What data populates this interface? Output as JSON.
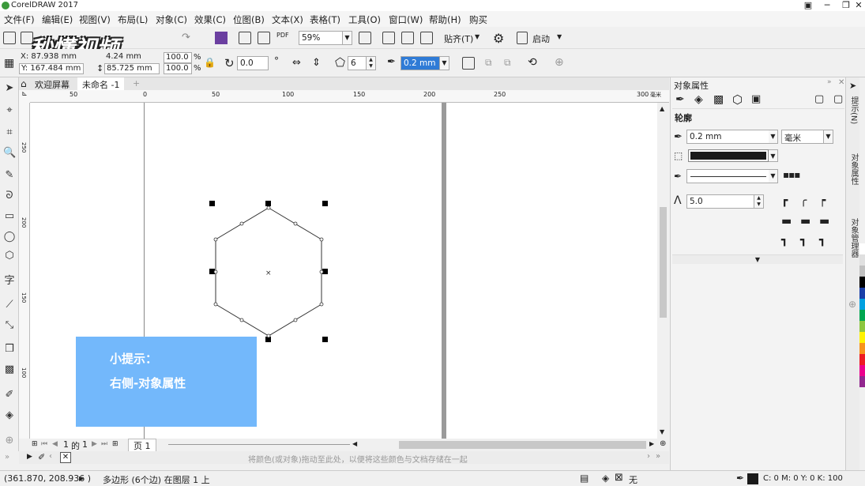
{
  "window": {
    "title": "CorelDRAW 2017",
    "buttons": [
      "─",
      "❐",
      "✕"
    ]
  },
  "menu": [
    "文件(F)",
    "编辑(E)",
    "视图(V)",
    "布局(L)",
    "对象(C)",
    "效果(C)",
    "位图(B)",
    "文本(X)",
    "表格(T)",
    "工具(O)",
    "窗口(W)",
    "帮助(H)",
    "购买"
  ],
  "watermark": "秒懂视频",
  "toolbar1": {
    "zoom": "59%",
    "snap_label": "贴齐(T)",
    "launch_label": "启动"
  },
  "toolbar2": {
    "x": "X: 87.938 mm",
    "y": "Y: 167.484 mm",
    "width": "4.24 mm",
    "height": "85.725 mm",
    "scale_x": "100.0",
    "scale_y": "100.0",
    "percent": "%",
    "rotation": "0.0",
    "degree": "°",
    "sides": "6",
    "outline": "0.2 mm"
  },
  "tabs": {
    "welcome": "欢迎屏幕",
    "doc": "未命名 -1",
    "add": "+"
  },
  "ruler_h": [
    "50",
    "0",
    "50",
    "100",
    "150",
    "200",
    "250",
    "300"
  ],
  "ruler_unit": "毫米",
  "ruler_v": [
    "250",
    "200",
    "150",
    "100"
  ],
  "hint": {
    "line1": "小提示：",
    "line2": "右侧-对象属性"
  },
  "page_nav": {
    "current": "1",
    "of": "的",
    "total": "1",
    "page_tab": "页 1"
  },
  "palette_hint": "将颜色(或对象)拖动至此处，以便将这些颜色与文档存储在一起",
  "status": {
    "coords": "(361.870, 208.936 )",
    "object": "多边形 (6个边) 在图层 1 上",
    "fill": "无",
    "outline_color": "C: 0 M: 0 Y: 0 K: 100"
  },
  "docker": {
    "title": "对象属性",
    "section": "轮廓",
    "width": "0.2 mm",
    "unit": "毫米",
    "miter": "5.0",
    "outline_color": "#1a1a1a",
    "tabs": [
      "提示(N)",
      "对象属性",
      "对象管理器"
    ]
  },
  "palette_colors": [
    "#ffffff",
    "#e0e0e0",
    "#c0c0c0",
    "#000000",
    "#1a3fa8",
    "#00a0e0",
    "#00a651",
    "#8dc63f",
    "#fff200",
    "#f7941d",
    "#ed1c24",
    "#ec008c",
    "#92278f"
  ]
}
